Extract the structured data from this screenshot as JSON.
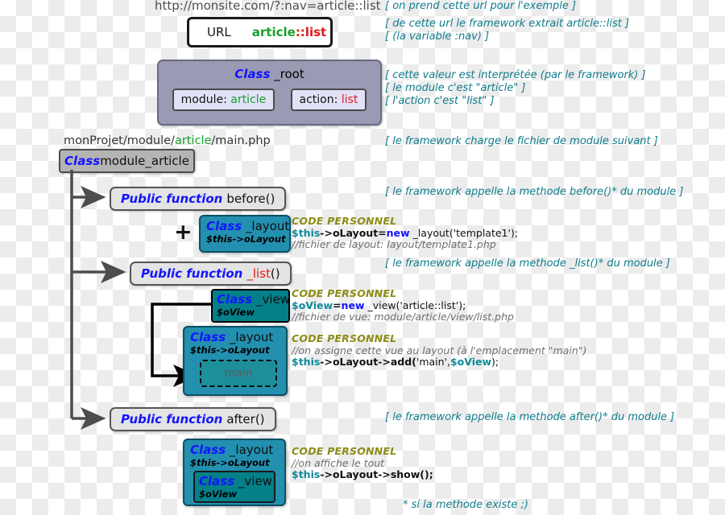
{
  "url_line": "http://monsite.com/?:nav=article::list",
  "url_box": {
    "label": "URL",
    "value_module": "article",
    "value_action": "::list"
  },
  "root_class": {
    "keyword": "Class",
    "name": " _root",
    "chips": [
      {
        "label": "module: ",
        "value": "article"
      },
      {
        "label": "action: ",
        "value": "list"
      }
    ]
  },
  "file_path": {
    "prefix": "monProjet/module/",
    "highlight": "article",
    "suffix": "/main.php"
  },
  "module_class": {
    "keyword": "Class",
    "name": " module_article"
  },
  "functions": {
    "before": {
      "keyword": "Public function",
      "name": "before()"
    },
    "list": {
      "keyword": "Public function",
      "name": "_list",
      "suffix": "()"
    },
    "after": {
      "keyword": "Public function",
      "name": "after()"
    }
  },
  "plus_sign": "+",
  "boxes": {
    "layout1": {
      "keyword": "Class",
      "name": " _layout",
      "sub": "$this->oLayout"
    },
    "view1": {
      "keyword": "Class",
      "name": " _view",
      "sub": "$oView"
    },
    "layout2": {
      "keyword": "Class",
      "name": " _layout",
      "sub": "$this->oLayout",
      "slot": "main"
    },
    "layout3": {
      "keyword": "Class",
      "name": " _layout",
      "sub": "$this->oLayout"
    },
    "view3": {
      "keyword": "Class",
      "name": " _view",
      "sub": "$oView"
    }
  },
  "code_blocks": {
    "block1": {
      "header": "CODE PERSONNEL",
      "line_var": "$this",
      "line_op": "->oLayout=",
      "line_kw": "new",
      "line_rest": " _layout('template1');",
      "comment": "//fichier de layout: layout/template1.php"
    },
    "block2": {
      "header": "CODE PERSONNEL",
      "line_var": "$oView",
      "line_op": "=",
      "line_kw": "new",
      "line_rest": " _view('article::list');",
      "comment": "//fichier de vue: module/article/view/list.php"
    },
    "block3": {
      "header": "CODE PERSONNEL",
      "comment": "//on assigne cette vue au layout (à l'emplacement \"main\")",
      "line_var": "$this",
      "line_op": "->oLayout->add(",
      "line_str": "'main'",
      "line_comma": ",",
      "line_var2": "$oView",
      "line_end": ");"
    },
    "block4": {
      "header": "CODE PERSONNEL",
      "comment": "//on affiche le tout",
      "line_var": "$this",
      "line_op": "->oLayout->show();"
    }
  },
  "notes": {
    "n1": "[ on prend cette url pour l'exemple ]",
    "n2": "[ de cette url le framework extrait article::list ]",
    "n2b": "[ (la variable :nav) ]",
    "n3": "[ cette valeur est interprétée (par le framework) ]",
    "n3b": "[ le module c'est \"article\" ]",
    "n3c": "[ l'action c'est \"list\" ]",
    "n4": "[ le framework charge le fichier de module suivant ]",
    "n5": "[ le framework appelle la methode before()* du module ]",
    "n6": "[ le framework appelle la methode _list()* du module ]",
    "n7": "[ le framework appelle la methode after()* du module ]",
    "n8": "* si la methode existe ;)"
  },
  "colors": {
    "keyword_blue": "#1414ff",
    "teal_note": "#0f7c8c",
    "green": "#18a02c",
    "red": "#e21b1b",
    "code_header": "#8c8c16",
    "box_layout": "#2390b0",
    "box_view": "#048089",
    "root_box": "#9a9ab4"
  }
}
